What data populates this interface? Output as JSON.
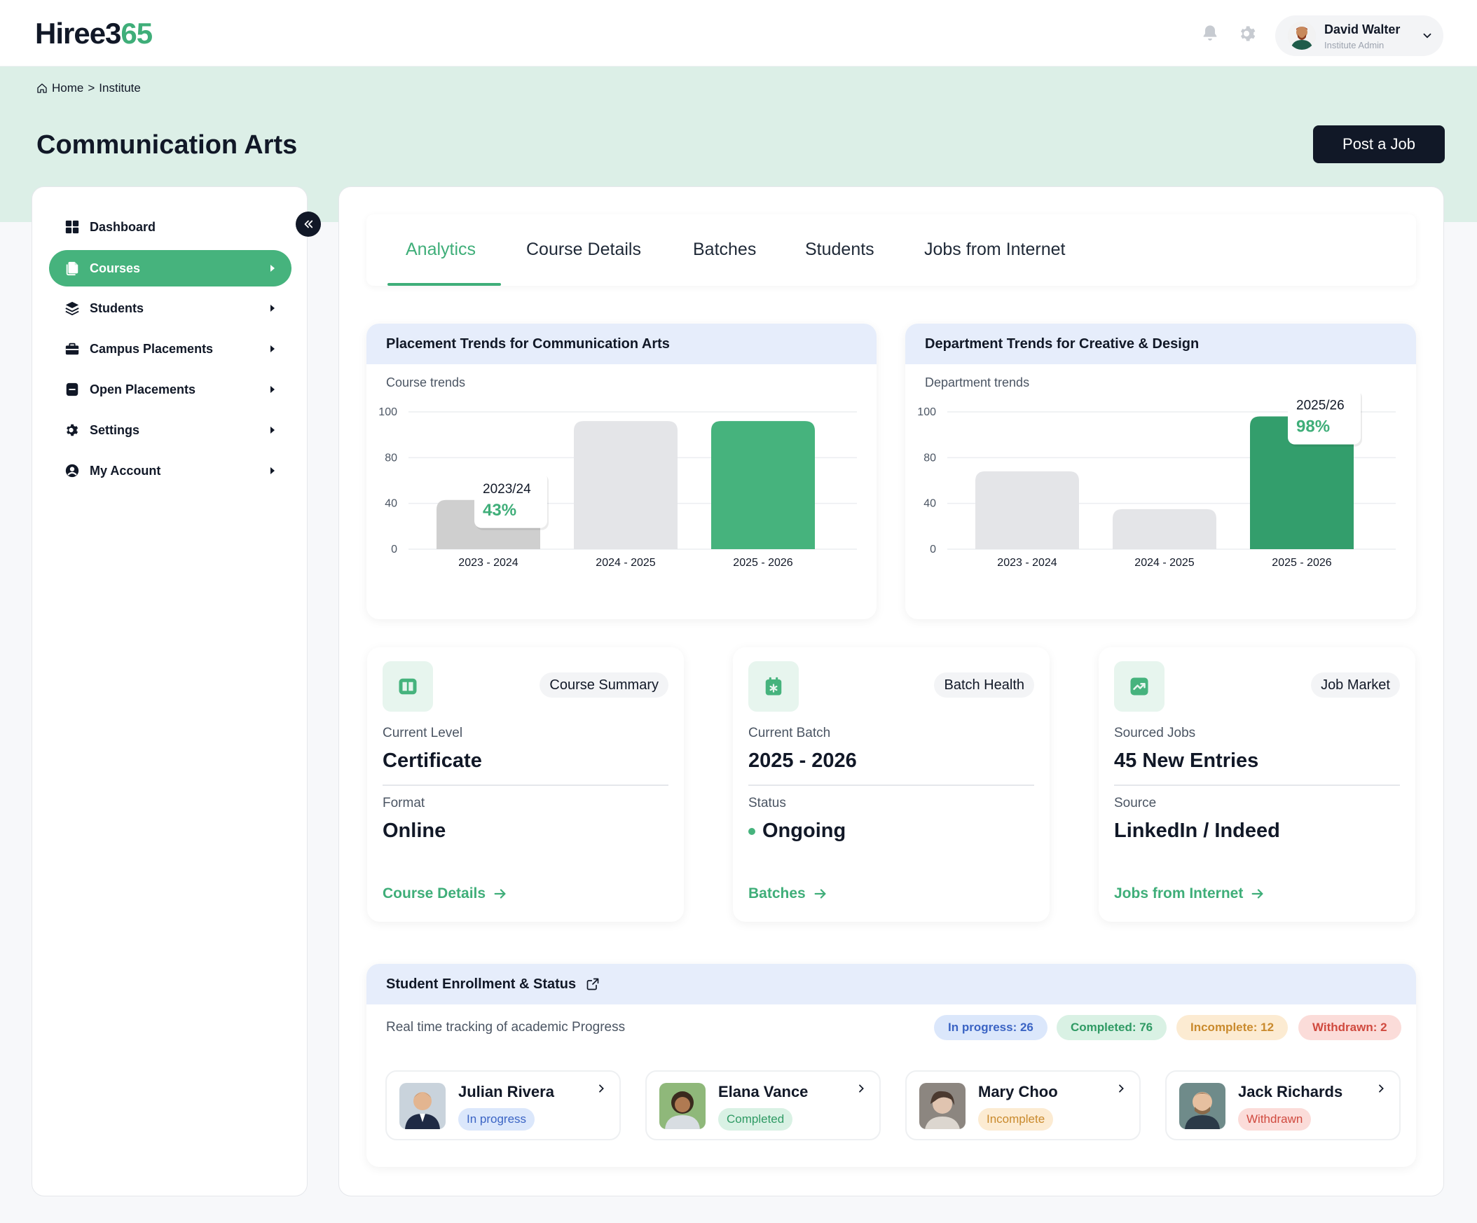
{
  "app": {
    "logo_main": "Hiree3",
    "logo_accent": "65"
  },
  "header": {
    "user_name": "David Walter",
    "user_role": "Institute Admin",
    "icons": [
      "bell-icon",
      "gear-icon",
      "chevron-down-icon"
    ]
  },
  "breadcrumb": {
    "home": "Home",
    "separator": ">",
    "current": "Institute"
  },
  "page": {
    "title": "Communication Arts",
    "post_job": "Post a Job"
  },
  "sidebar": {
    "items": [
      {
        "label": "Dashboard",
        "icon": "grid-icon",
        "active": false,
        "caret": false
      },
      {
        "label": "Courses",
        "icon": "files-icon",
        "active": true,
        "caret": true
      },
      {
        "label": "Students",
        "icon": "layers-icon",
        "active": false,
        "caret": true
      },
      {
        "label": "Campus Placements",
        "icon": "briefcase-icon",
        "active": false,
        "caret": true
      },
      {
        "label": "Open Placements",
        "icon": "folder-icon",
        "active": false,
        "caret": true
      },
      {
        "label": "Settings",
        "icon": "gear-icon",
        "active": false,
        "caret": true
      },
      {
        "label": "My Account",
        "icon": "user-circle-icon",
        "active": false,
        "caret": true
      }
    ]
  },
  "tabs": [
    "Analytics",
    "Course Details",
    "Batches",
    "Students",
    "Jobs from Internet"
  ],
  "charts": {
    "placement": {
      "title": "Placement Trends for Communication Arts",
      "subtitle": "Course trends"
    },
    "department": {
      "title": "Department Trends for Creative & Design",
      "subtitle": "Department trends"
    }
  },
  "chart_data": [
    {
      "type": "bar",
      "title": "Placement Trends for Communication Arts",
      "subtitle": "Course trends",
      "categories": [
        "2023 - 2024",
        "2024 - 2025",
        "2025 - 2026"
      ],
      "values": [
        43,
        96,
        96
      ],
      "y_ticks": [
        "100",
        "80",
        "40",
        "0"
      ],
      "colors": [
        "#cfcfcf",
        "#e4e5e8",
        "#46b37d"
      ],
      "tooltip": {
        "label": "2023/24",
        "value": "43%",
        "index": 0
      },
      "grid": true
    },
    {
      "type": "bar",
      "title": "Department Trends for Creative & Design",
      "subtitle": "Department trends",
      "categories": [
        "2023 - 2024",
        "2024 - 2025",
        "2025 - 2026"
      ],
      "values": [
        68,
        35,
        98
      ],
      "y_ticks": [
        "100",
        "80",
        "40",
        "0"
      ],
      "colors": [
        "#e4e5e8",
        "#e4e5e8",
        "#339e6c"
      ],
      "tooltip": {
        "label": "2025/26",
        "value": "98%",
        "index": 2
      },
      "grid": true
    }
  ],
  "summary": [
    {
      "pill": "Course Summary",
      "icon": "book-icon",
      "label1": "Current Level",
      "value1": "Certificate",
      "label2": "Format",
      "value2": "Online",
      "link": "Course Details",
      "status_dot": false
    },
    {
      "pill": "Batch Health",
      "icon": "calendar-icon",
      "label1": "Current Batch",
      "value1": "2025 - 2026",
      "label2": "Status",
      "value2": "Ongoing",
      "link": "Batches",
      "status_dot": true
    },
    {
      "pill": "Job Market",
      "icon": "trend-icon",
      "label1": "Sourced Jobs",
      "value1": "45 New Entries",
      "label2": "Source",
      "value2": "LinkedIn / Indeed",
      "link": "Jobs from Internet",
      "status_dot": false
    }
  ],
  "enrollment": {
    "title": "Student Enrollment & Status",
    "subtitle": "Real time tracking of academic Progress",
    "badges": [
      "In progress: 26",
      "Completed: 76",
      "Incomplete: 12",
      "Withdrawn: 2"
    ],
    "students": [
      {
        "name": "Julian Rivera",
        "status": "In progress",
        "kind": "prog"
      },
      {
        "name": "Elana Vance",
        "status": "Completed",
        "kind": "comp"
      },
      {
        "name": "Mary Choo",
        "status": "Incomplete",
        "kind": "inc"
      },
      {
        "name": "Jack Richards",
        "status": "Withdrawn",
        "kind": "wd"
      }
    ]
  }
}
